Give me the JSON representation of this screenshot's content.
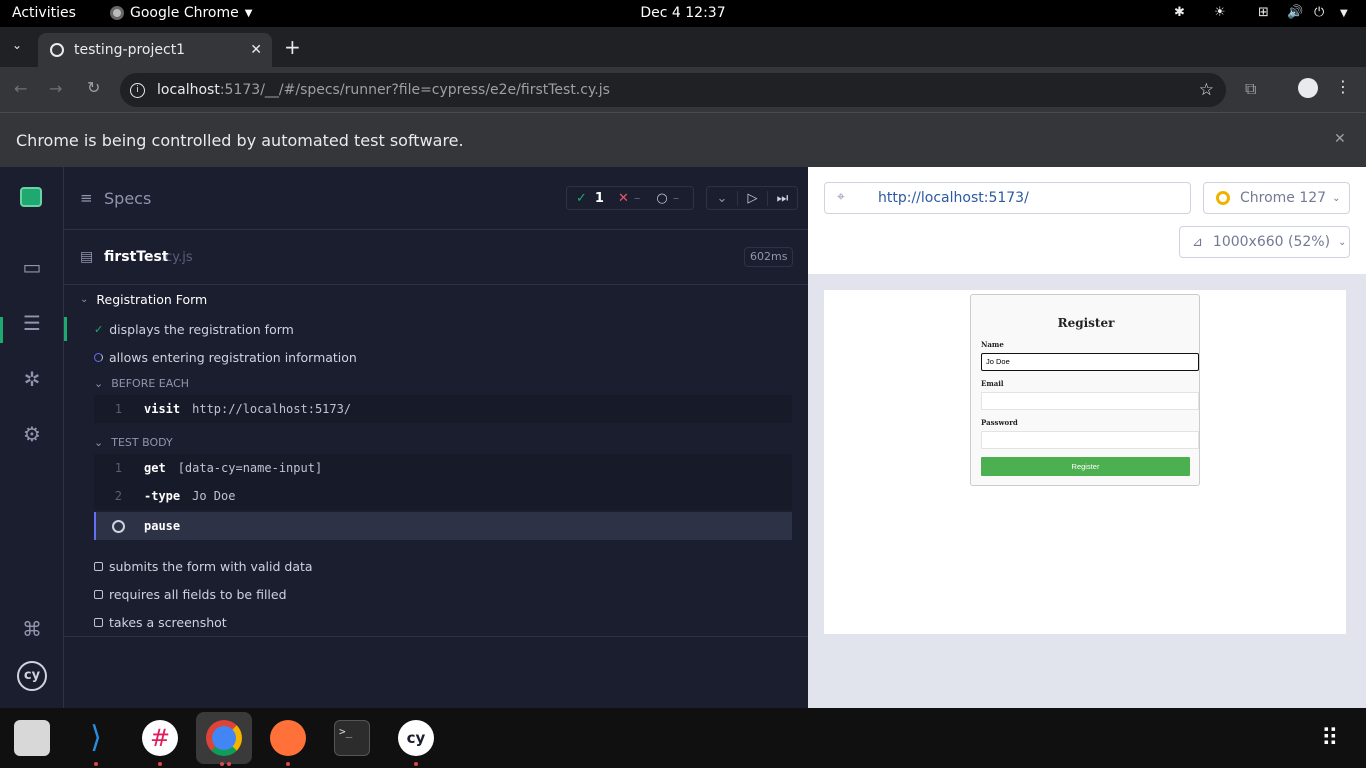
{
  "system": {
    "activities": "Activities",
    "app_name": "Google Chrome",
    "clock": "Dec 4  12:37"
  },
  "browser": {
    "tab_title": "testing-project1",
    "url_host": "localhost",
    "url_rest": ":5173/__/#/specs/runner?file=cypress/e2e/firstTest.cy.js",
    "infobar_text": "Chrome is being controlled by automated test software."
  },
  "reporter": {
    "specs_label": "Specs",
    "passed_count": "1",
    "failed_count": "–",
    "pending_count": "–",
    "spec_name": "firstTest",
    "spec_ext": ".cy.js",
    "duration": "602ms",
    "suite_title": "Registration Form",
    "tests": [
      {
        "title": "displays the registration form",
        "state": "passed"
      },
      {
        "title": "allows entering registration information",
        "state": "running"
      },
      {
        "title": "submits the form with valid data",
        "state": "pending"
      },
      {
        "title": "requires all fields to be filled",
        "state": "pending"
      },
      {
        "title": "takes a screenshot",
        "state": "pending"
      }
    ],
    "before_each_label": "BEFORE EACH",
    "test_body_label": "TEST BODY",
    "commands": {
      "before": [
        {
          "num": "1",
          "name": "visit",
          "arg": "http://localhost:5173/"
        }
      ],
      "body": [
        {
          "num": "1",
          "name": "get",
          "arg": "[data-cy=name-input]"
        },
        {
          "num": "2",
          "name": "-type",
          "arg": "Jo Doe"
        },
        {
          "num": "",
          "name": "pause",
          "arg": ""
        }
      ]
    }
  },
  "aut": {
    "url": "http://localhost:5173/",
    "browser_label": "Chrome 127",
    "viewport_label": "1000x660 (52%)",
    "form": {
      "title": "Register",
      "name_label": "Name",
      "name_value": "Jo Doe",
      "email_label": "Email",
      "password_label": "Password",
      "submit_label": "Register"
    }
  },
  "colors": {
    "accent_green": "#1fa971",
    "register_btn": "#4caf50",
    "link_blue": "#2c5aa0"
  }
}
